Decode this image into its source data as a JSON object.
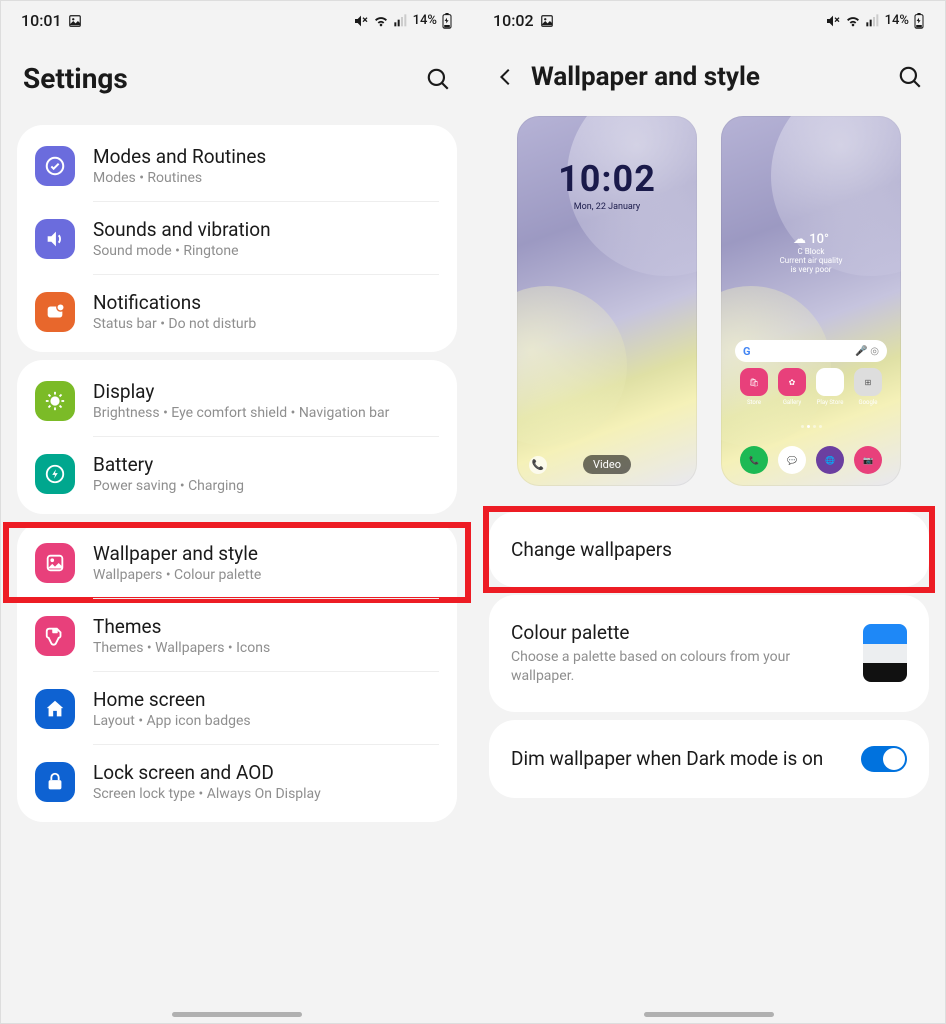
{
  "left": {
    "status": {
      "time": "10:01",
      "battery": "14%"
    },
    "header": "Settings",
    "groups": [
      {
        "items": [
          {
            "icon": "modes",
            "color": "#6b6cdd",
            "title": "Modes and Routines",
            "sub": "Modes  •  Routines"
          },
          {
            "icon": "sound",
            "color": "#6b6cdd",
            "title": "Sounds and vibration",
            "sub": "Sound mode  •  Ringtone"
          },
          {
            "icon": "notif",
            "color": "#e8672c",
            "title": "Notifications",
            "sub": "Status bar  •  Do not disturb"
          }
        ]
      },
      {
        "items": [
          {
            "icon": "display",
            "color": "#7bbb27",
            "title": "Display",
            "sub": "Brightness  •  Eye comfort shield  •  Navigation bar"
          },
          {
            "icon": "battery",
            "color": "#00a78e",
            "title": "Battery",
            "sub": "Power saving  •  Charging"
          }
        ]
      },
      {
        "items": [
          {
            "icon": "wallpaper",
            "color": "#e8407b",
            "title": "Wallpaper and style",
            "sub": "Wallpapers  •  Colour palette",
            "highlight": true
          },
          {
            "icon": "themes",
            "color": "#e8407b",
            "title": "Themes",
            "sub": "Themes  •  Wallpapers  •  Icons"
          },
          {
            "icon": "home",
            "color": "#0e62d2",
            "title": "Home screen",
            "sub": "Layout  •  App icon badges"
          },
          {
            "icon": "lock",
            "color": "#0e62d2",
            "title": "Lock screen and AOD",
            "sub": "Screen lock type  •  Always On Display"
          }
        ]
      }
    ]
  },
  "right": {
    "status": {
      "time": "10:02",
      "battery": "14%"
    },
    "header": "Wallpaper and style",
    "lock": {
      "time": "10:02",
      "date": "Mon, 22 January",
      "video": "Video"
    },
    "home_widget": {
      "temp": "10°",
      "loc": "C Block",
      "note": "Current air quality\nis very poor"
    },
    "change": "Change wallpapers",
    "palette": {
      "title": "Colour palette",
      "sub": "Choose a palette based on colours from your wallpaper.",
      "colors": [
        "#1e88f7",
        "#eceef0",
        "#111111"
      ]
    },
    "dim": {
      "title": "Dim wallpaper when Dark mode is on",
      "on": true
    }
  }
}
